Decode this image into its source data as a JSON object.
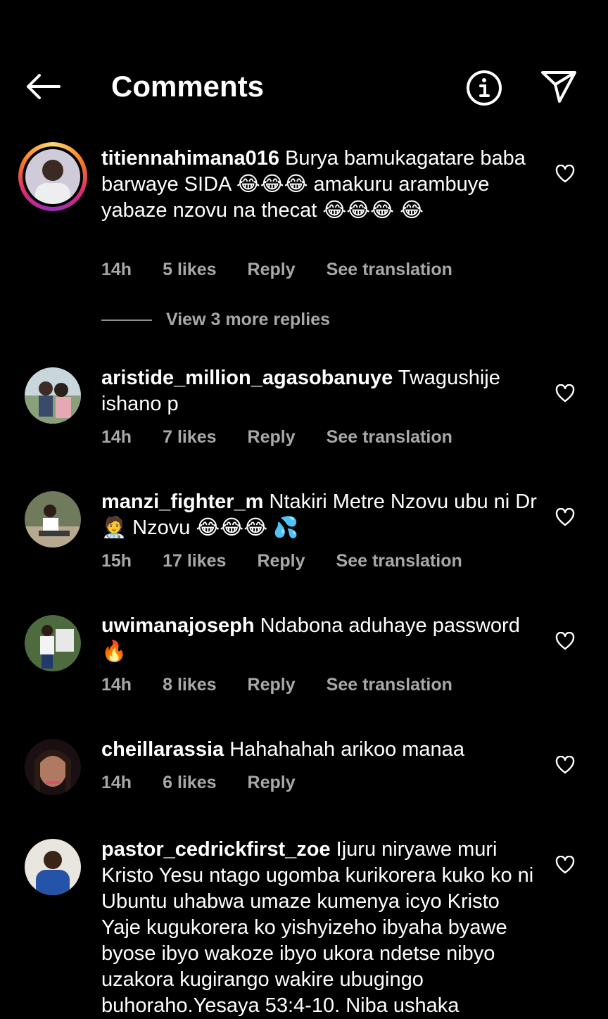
{
  "header": {
    "title": "Comments"
  },
  "icons": {
    "back": "arrow-left-icon",
    "info": "info-icon",
    "send": "paper-plane-icon",
    "like": "heart-icon"
  },
  "comments": [
    {
      "username": "titiennahimana016",
      "text": "Burya bamukagatare baba barwaye SIDA 😂😂😂 amakuru arambuye yabaze nzovu na thecat 😂😂😂 😂",
      "time": "14h",
      "likes": "5 likes",
      "reply": "Reply",
      "translate": "See translation",
      "view_replies": "View 3 more replies"
    },
    {
      "username": "aristide_million_agasobanuye",
      "text": "Twagushije ishano p",
      "time": "14h",
      "likes": "7 likes",
      "reply": "Reply",
      "translate": "See translation"
    },
    {
      "username": "manzi_fighter_m",
      "text": "Ntakiri Metre Nzovu ubu ni Dr 🧑‍⚕️ Nzovu 😂😂😂 💦",
      "time": "15h",
      "likes": "17 likes",
      "reply": "Reply",
      "translate": "See translation"
    },
    {
      "username": "uwimanajoseph",
      "text": "Ndabona aduhaye password 🔥",
      "time": "14h",
      "likes": "8 likes",
      "reply": "Reply",
      "translate": "See translation"
    },
    {
      "username": "cheillarassia",
      "text": "Hahahahah arikoo manaa",
      "time": "14h",
      "likes": "6 likes",
      "reply": "Reply"
    },
    {
      "username": "pastor_cedrickfirst_zoe",
      "text": "Ijuru niryawe muri Kristo Yesu ntago ugomba kurikorera kuko ko ni Ubuntu uhabwa umaze kumenya icyo Kristo Yaje kugukorera ko yishyizeho ibyaha byawe byose ibyo wakoze ibyo ukora ndetse nibyo uzakora kugirango wakire ubugingo buhoraho.Yesaya 53:4-10. Niba ushaka"
    }
  ]
}
